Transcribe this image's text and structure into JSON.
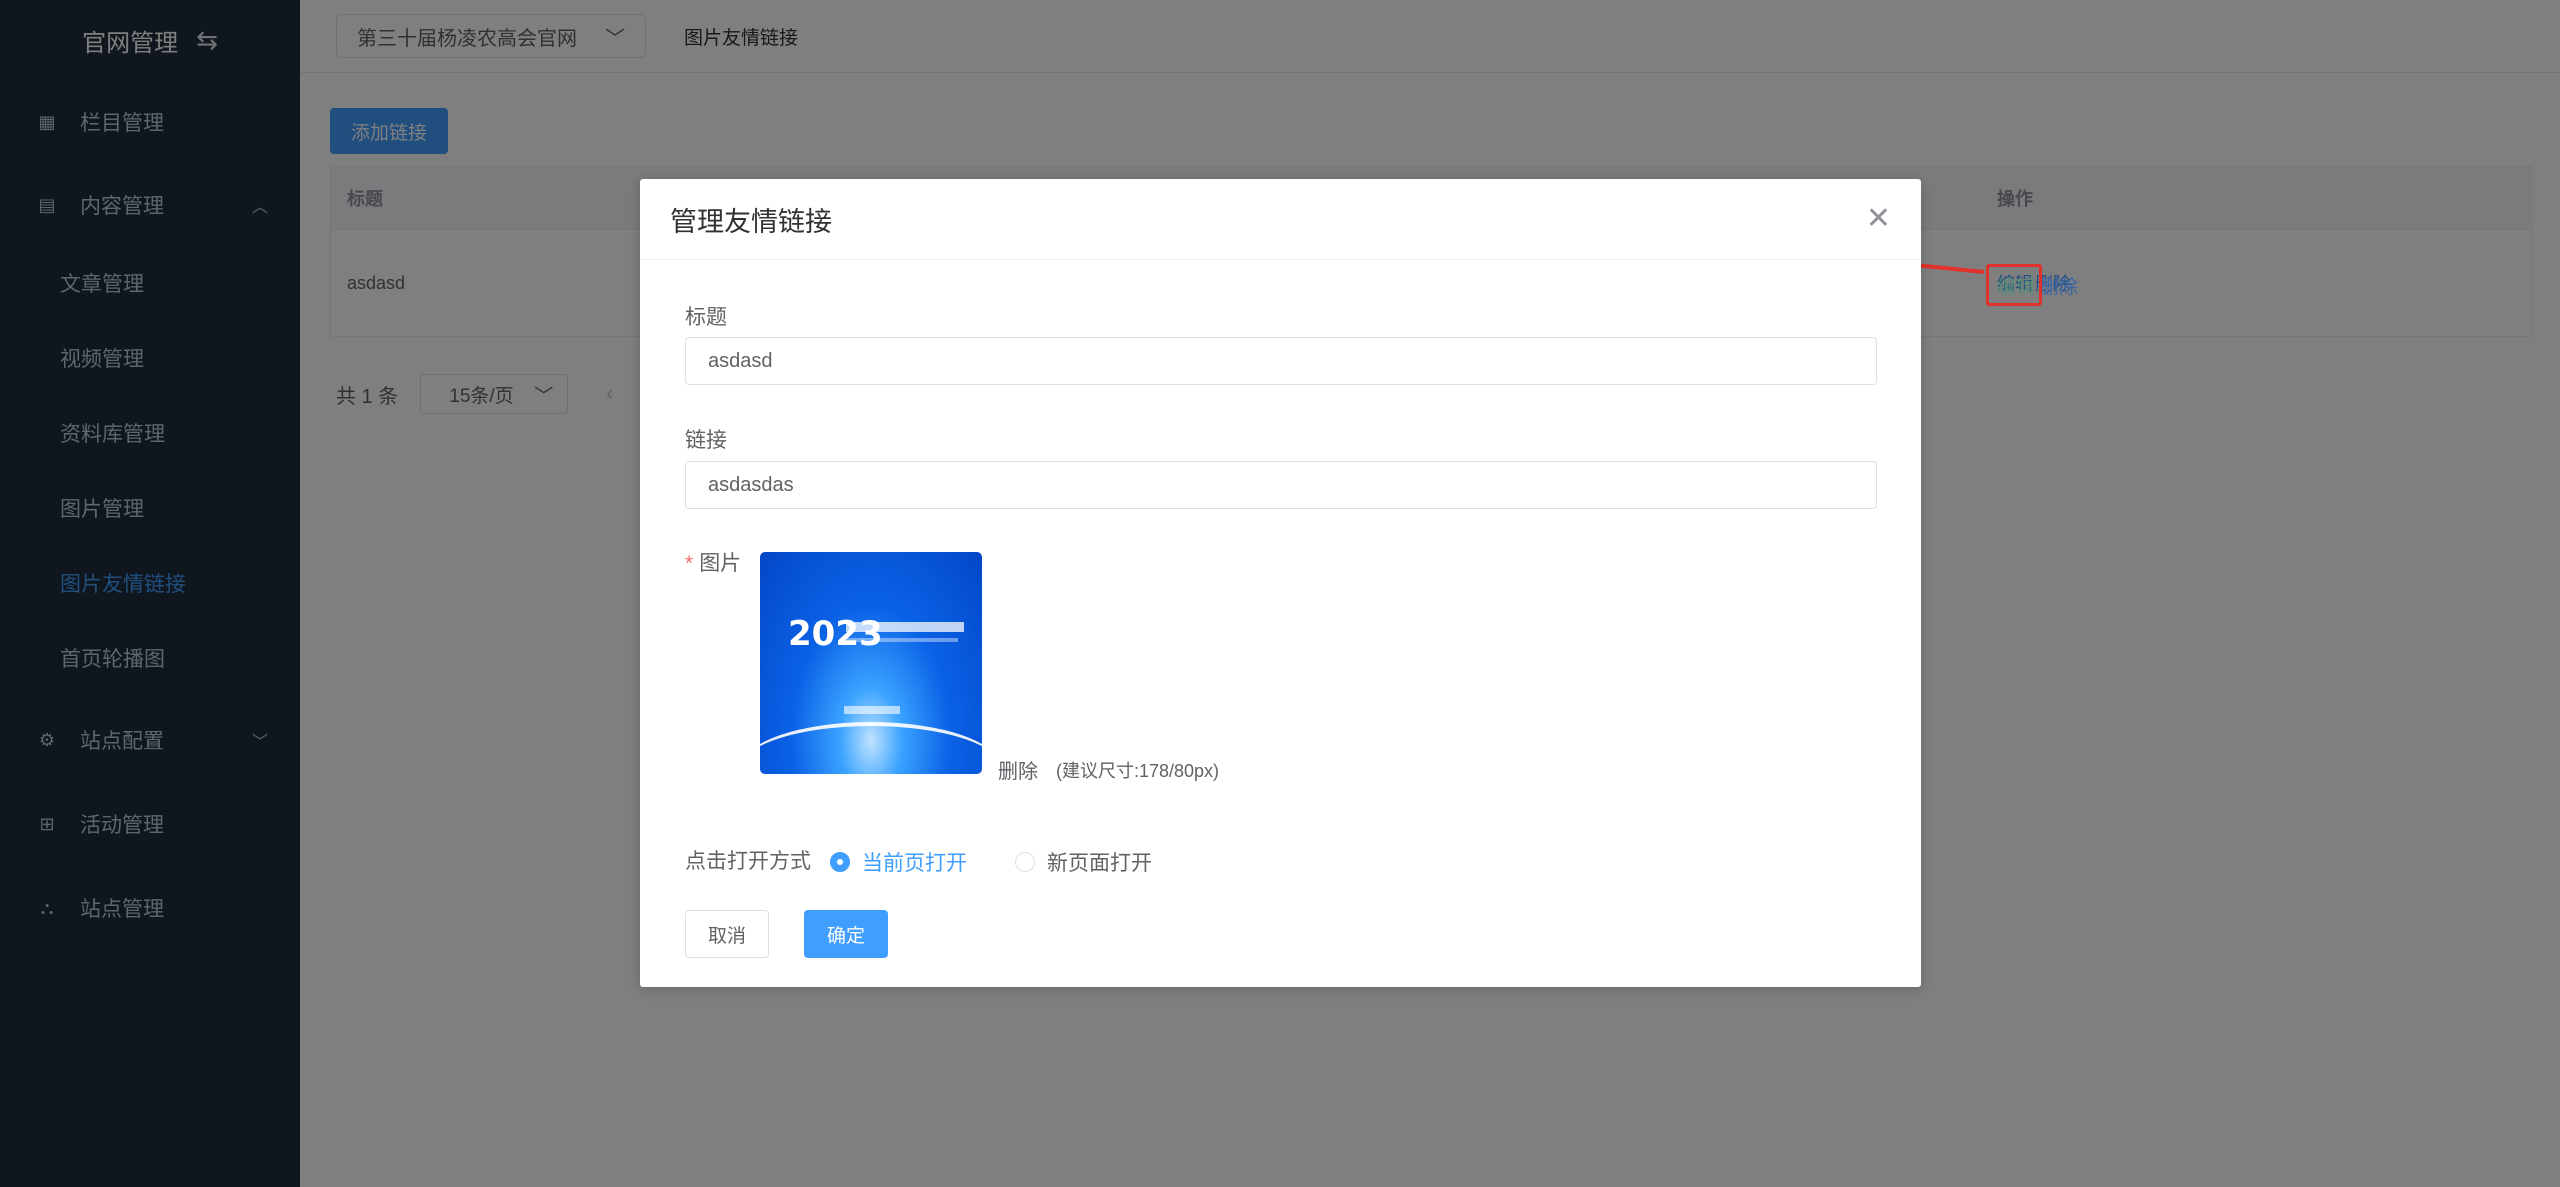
{
  "sidebar": {
    "brand": "官网管理",
    "swap_icon": "swap-icon",
    "items": [
      {
        "label": "栏目管理",
        "icon": "grid-icon"
      },
      {
        "label": "内容管理",
        "icon": "document-icon",
        "expanded": true
      },
      {
        "label": "站点配置",
        "icon": "config-icon"
      },
      {
        "label": "活动管理",
        "icon": "plus-box-icon"
      },
      {
        "label": "站点管理",
        "icon": "sitemap-icon"
      }
    ],
    "subitems": [
      "文章管理",
      "视频管理",
      "资料库管理",
      "图片管理",
      "图片友情链接",
      "首页轮播图"
    ],
    "active_subitem": "图片友情链接"
  },
  "topbar": {
    "site_select": "第三十届杨凌农高会官网",
    "breadcrumb": "图片友情链接"
  },
  "toolbar": {
    "add_label": "添加链接"
  },
  "table": {
    "headers": {
      "title": "标题",
      "ops": "操作"
    },
    "rows": [
      {
        "title": "asdasd",
        "edit": "编辑",
        "delete": "删除"
      }
    ]
  },
  "pager": {
    "total": "共 1 条",
    "page_size": "15条/页"
  },
  "dialog": {
    "title": "管理友情链接",
    "title_label": "标题",
    "title_value": "asdasd",
    "link_label": "链接",
    "link_value": "asdasdas",
    "image_required": "*",
    "image_label": "图片",
    "image_year": "2023",
    "image_delete": "删除",
    "image_tip": "(建议尺寸:178/80px)",
    "open_label": "点击打开方式",
    "open_current": "当前页打开",
    "open_new": "新页面打开",
    "cancel": "取消",
    "confirm": "确定"
  },
  "colors": {
    "primary": "#409eff",
    "sidebar_bg": "#1f2d3d",
    "annotation": "#e0312d"
  }
}
